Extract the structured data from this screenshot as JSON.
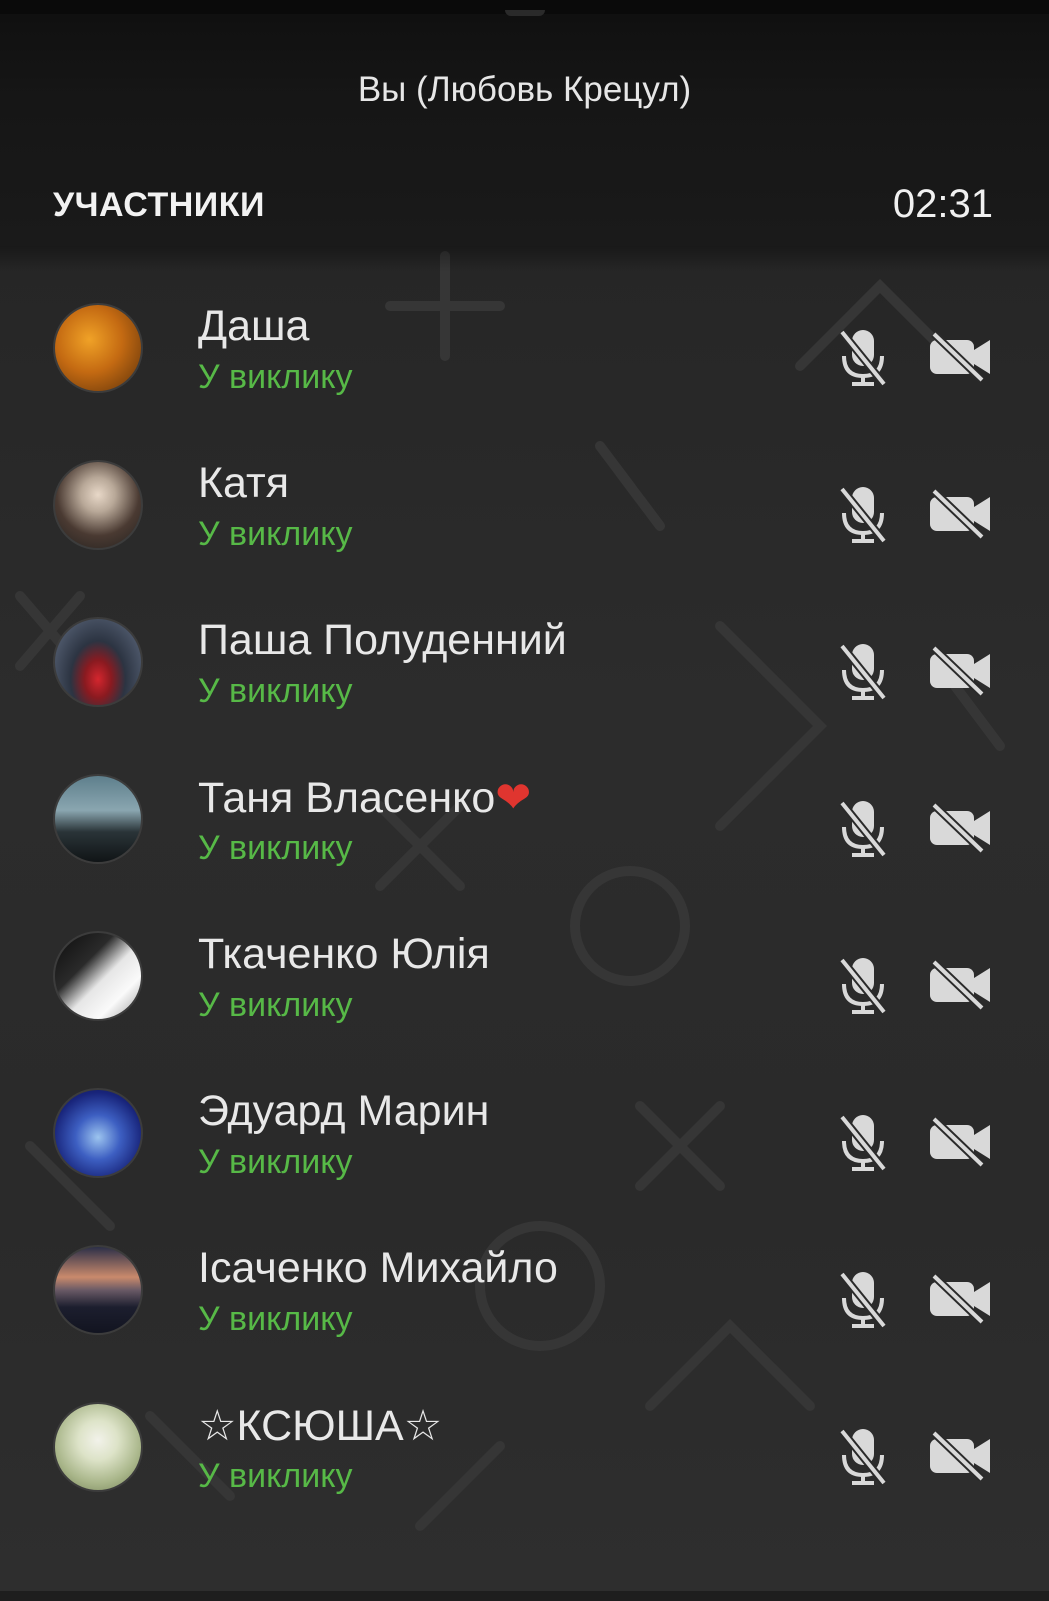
{
  "header": {
    "you_label": "Вы (Любовь Крецул)",
    "section_title": "УЧАСТНИКИ",
    "timer": "02:31"
  },
  "colors": {
    "status_green": "#57b947",
    "background_dark": "#1c1c1c",
    "icon_grey": "#d9d9d9"
  },
  "participants": [
    {
      "name": "Даша",
      "status": "У виклику",
      "avatar_colors": [
        "#e0871c",
        "#6b3a0c"
      ]
    },
    {
      "name": "Катя",
      "status": "У виклику",
      "avatar_colors": [
        "#b8b2a8",
        "#3a2f2a"
      ]
    },
    {
      "name": "Паша Полуденний",
      "status": "У виклику",
      "avatar_colors": [
        "#2d3646",
        "#c4232b"
      ]
    },
    {
      "name": "Таня Власенко",
      "status": "У виклику",
      "name_suffix": "❤",
      "avatar_colors": [
        "#6d8a96",
        "#12181c"
      ]
    },
    {
      "name": "Ткаченко Юлія",
      "status": "У виклику",
      "avatar_colors": [
        "#f2f2f2",
        "#111111"
      ]
    },
    {
      "name": "Эдуард Марин",
      "status": "У виклику",
      "avatar_colors": [
        "#1c2b8a",
        "#8bb3e6"
      ]
    },
    {
      "name": "Ісаченко Михайло",
      "status": "У виклику",
      "avatar_colors": [
        "#c98a6c",
        "#1c1e2e"
      ]
    },
    {
      "name": "☆КСЮША☆",
      "status": "У виклику",
      "avatar_colors": [
        "#dde3c8",
        "#8c9a6a"
      ]
    }
  ],
  "icons": {
    "mic": "mic-off-icon",
    "camera": "camera-off-icon"
  }
}
